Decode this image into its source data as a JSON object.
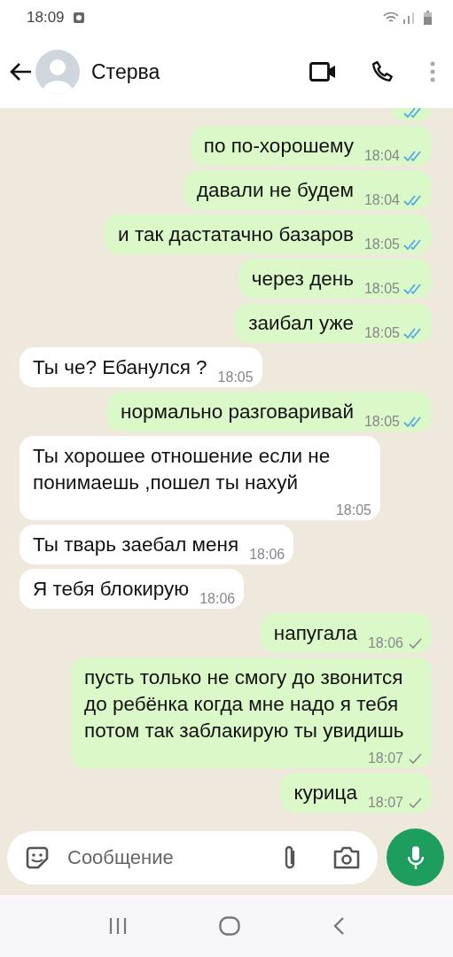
{
  "status_bar": {
    "time": "18:09"
  },
  "header": {
    "contact": "Стерва"
  },
  "messages": [
    {
      "kind": "outgoing",
      "read": true
    },
    {
      "kind": "outgoing",
      "text": "по по-хорошему",
      "time": "18:04",
      "read": true
    },
    {
      "kind": "outgoing",
      "text": "давали не будем",
      "time": "18:04",
      "read": true
    },
    {
      "kind": "outgoing",
      "text": "и так дастатачно базаров",
      "time": "18:05",
      "read": true
    },
    {
      "kind": "outgoing",
      "text": "через день",
      "time": "18:05",
      "read": true
    },
    {
      "kind": "outgoing",
      "text": "заибал уже",
      "time": "18:05",
      "read": true
    },
    {
      "kind": "incoming",
      "text": "Ты че? Ебанулся ?",
      "time": "18:05"
    },
    {
      "kind": "outgoing",
      "text": "нормально разговаривай",
      "time": "18:05",
      "read": true
    },
    {
      "kind": "incoming",
      "text": "Ты хорошее отношение если не понимаешь ,пошел ты нахуй",
      "time": "18:05"
    },
    {
      "kind": "incoming",
      "text": "Ты тварь заебал меня",
      "time": "18:06"
    },
    {
      "kind": "incoming",
      "text": "Я тебя блокирую",
      "time": "18:06"
    },
    {
      "kind": "outgoing",
      "text": "напугала",
      "time": "18:06",
      "read": false
    },
    {
      "kind": "outgoing",
      "text": "пусть только не смогу до звонится до ребёнка когда мне надо я тебя потом так заблакирую ты увидишь",
      "time": "18:07",
      "read": false
    },
    {
      "kind": "outgoing",
      "text": "курица",
      "time": "18:07",
      "read": false
    }
  ],
  "composer": {
    "placeholder": "Сообщение"
  }
}
